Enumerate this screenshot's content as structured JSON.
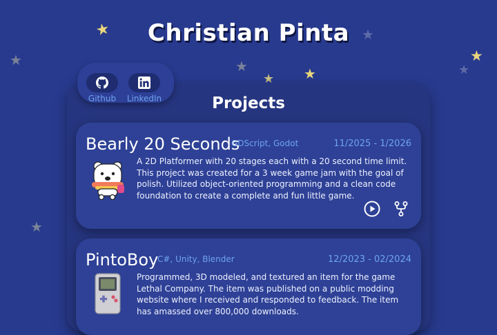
{
  "header": {
    "title": "Christian Pinta"
  },
  "social": {
    "github_label": "Github",
    "linkedin_label": "LinkedIn",
    "github_icon": "github-icon",
    "linkedin_icon": "linkedin-icon"
  },
  "projects": {
    "title": "Projects",
    "items": [
      {
        "name": "Bearly 20 Seconds",
        "tech": "GDScript, Godot",
        "date": "11/2025 - 1/2026",
        "description": "A 2D Platformer with 20 stages each with a 20 second time limit. This project was created for a 3 week game jam with the goal of polish. Utilized object-oriented programming and a clean code foundation to create a complete and fun little game.",
        "thumbnail_icon": "bear-character-icon",
        "actions": [
          "play-icon",
          "fork-icon"
        ]
      },
      {
        "name": "PintoBoy",
        "tech": "C#, Unity, Blender",
        "date": "12/2023 - 02/2024",
        "description": "Programmed, 3D modeled, and textured an item for the game Lethal Company. The item was published on a public modding website where I received and responded to feedback. The item has amassed over 800,000 downloads.",
        "thumbnail_icon": "handheld-console-icon"
      }
    ]
  },
  "colors": {
    "background": "#283a8e",
    "panel": "#26357f",
    "card": "#2e4196",
    "accent": "#6fa3ee",
    "star_yellow": "#e9d67c",
    "star_gray": "#7a8299"
  }
}
